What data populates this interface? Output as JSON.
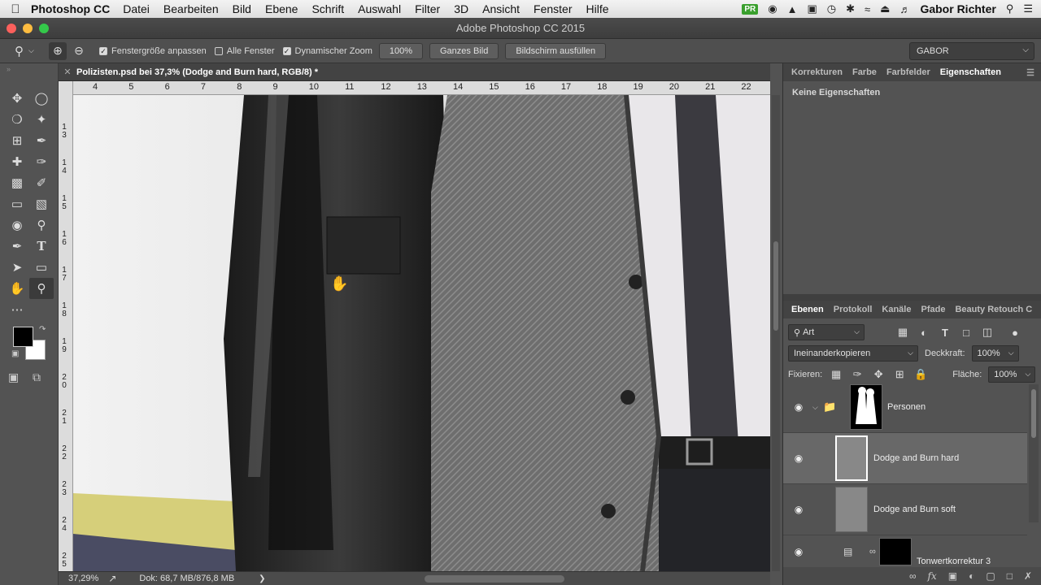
{
  "menubar": {
    "app_name": "Photoshop CC",
    "items": [
      "Datei",
      "Bearbeiten",
      "Bild",
      "Ebene",
      "Schrift",
      "Auswahl",
      "Filter",
      "3D",
      "Ansicht",
      "Fenster",
      "Hilfe"
    ],
    "user": "Gabor Richter",
    "badge": "PR"
  },
  "window": {
    "title": "Adobe Photoshop CC 2015"
  },
  "options": {
    "fit_window_label": "Fenstergröße anpassen",
    "fit_window_checked": true,
    "all_windows_label": "Alle Fenster",
    "all_windows_checked": false,
    "scrubby_zoom_label": "Dynamischer Zoom",
    "scrubby_zoom_checked": true,
    "zoom_value": "100%",
    "whole_image_label": "Ganzes Bild",
    "fill_screen_label": "Bildschirm ausfüllen",
    "workspace": "GABOR"
  },
  "document": {
    "tab_title": "Polizisten.psd bei 37,3% (Dodge and Burn hard, RGB/8) *",
    "zoom": "37,29%",
    "doc_info": "Dok: 68,7 MB/876,8 MB"
  },
  "rulers": {
    "horizontal": [
      "4",
      "5",
      "6",
      "7",
      "8",
      "9",
      "10",
      "11",
      "12",
      "13",
      "14",
      "15",
      "16",
      "17",
      "18",
      "19",
      "20",
      "21",
      "22"
    ],
    "vertical": [
      "1\n3",
      "1\n4",
      "1\n5",
      "1\n6",
      "1\n7",
      "1\n8",
      "1\n9",
      "2\n0",
      "2\n1",
      "2\n2",
      "2\n3",
      "2\n4",
      "2\n5"
    ]
  },
  "panels": {
    "top_tabs": [
      "Korrekturen",
      "Farbe",
      "Farbfelder",
      "Eigenschaften"
    ],
    "top_active": "Eigenschaften",
    "properties_empty": "Keine Eigenschaften",
    "layer_tabs": [
      "Ebenen",
      "Protokoll",
      "Kanäle",
      "Pfade",
      "Beauty Retouch C"
    ],
    "layer_active": "Ebenen",
    "filter_kind": "Art",
    "blend_mode": "Ineinanderkopieren",
    "opacity_label": "Deckkraft:",
    "opacity_value": "100%",
    "lock_label": "Fixieren:",
    "fill_label": "Fläche:",
    "fill_value": "100%",
    "layers": [
      {
        "name": "Personen",
        "type": "group"
      },
      {
        "name": "Dodge and Burn hard",
        "type": "pixel",
        "selected": true
      },
      {
        "name": "Dodge and Burn soft",
        "type": "pixel"
      },
      {
        "name": "Tonwertkorrektur 3",
        "type": "adjustment"
      }
    ]
  },
  "colors": {
    "accent_green": "#3aa02e",
    "panel_bg": "#535353",
    "selected_layer": "#686868"
  }
}
